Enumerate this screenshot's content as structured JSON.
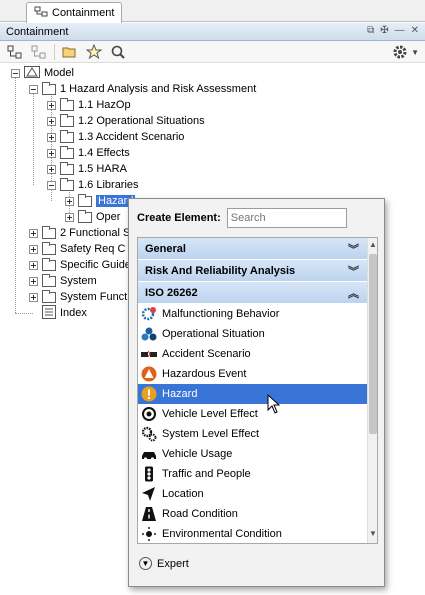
{
  "window": {
    "tab_label": "Containment"
  },
  "panel": {
    "title": "Containment"
  },
  "toolbar": {
    "icons": [
      "expand-tree-icon",
      "collapse-tree-icon",
      "open-folder-icon",
      "star-icon",
      "search-icon",
      "gear-icon",
      "dropdown-icon"
    ]
  },
  "tree": {
    "root": "Model",
    "items": [
      "1 Hazard Analysis and Risk Assessment",
      "1.1 HazOp",
      "1.2 Operational Situations",
      "1.3 Accident Scenario",
      "1.4 Effects",
      "1.5 HARA",
      "1.6 Libraries",
      "Hazard",
      "Oper",
      "2 Functional S",
      "Safety Req C",
      "Specific Guide",
      "System",
      "System Funct",
      "Index"
    ]
  },
  "popup": {
    "create_label": "Create Element:",
    "search_placeholder": "Search",
    "categories": [
      {
        "label": "General",
        "state": "collapsed"
      },
      {
        "label": "Risk And Reliability Analysis",
        "state": "collapsed"
      },
      {
        "label": "ISO 26262",
        "state": "expanded"
      }
    ],
    "items": [
      {
        "label": "Malfunctioning Behavior",
        "icon": "malfunction-icon"
      },
      {
        "label": "Operational Situation",
        "icon": "operational-situation-icon"
      },
      {
        "label": "Accident Scenario",
        "icon": "accident-icon"
      },
      {
        "label": "Hazardous Event",
        "icon": "hazardous-event-icon"
      },
      {
        "label": "Hazard",
        "icon": "hazard-icon",
        "selected": true
      },
      {
        "label": "Vehicle Level Effect",
        "icon": "vehicle-effect-icon"
      },
      {
        "label": "System Level Effect",
        "icon": "system-effect-icon"
      },
      {
        "label": "Vehicle Usage",
        "icon": "vehicle-usage-icon"
      },
      {
        "label": "Traffic and People",
        "icon": "traffic-light-icon"
      },
      {
        "label": "Location",
        "icon": "location-icon"
      },
      {
        "label": "Road Condition",
        "icon": "road-icon"
      },
      {
        "label": "Environmental Condition",
        "icon": "environment-icon"
      }
    ],
    "expert_label": "Expert"
  },
  "colors": {
    "selection": "#3875d7",
    "category_bg": "#c9dcf3",
    "hazard_orange": "#e8a020"
  }
}
